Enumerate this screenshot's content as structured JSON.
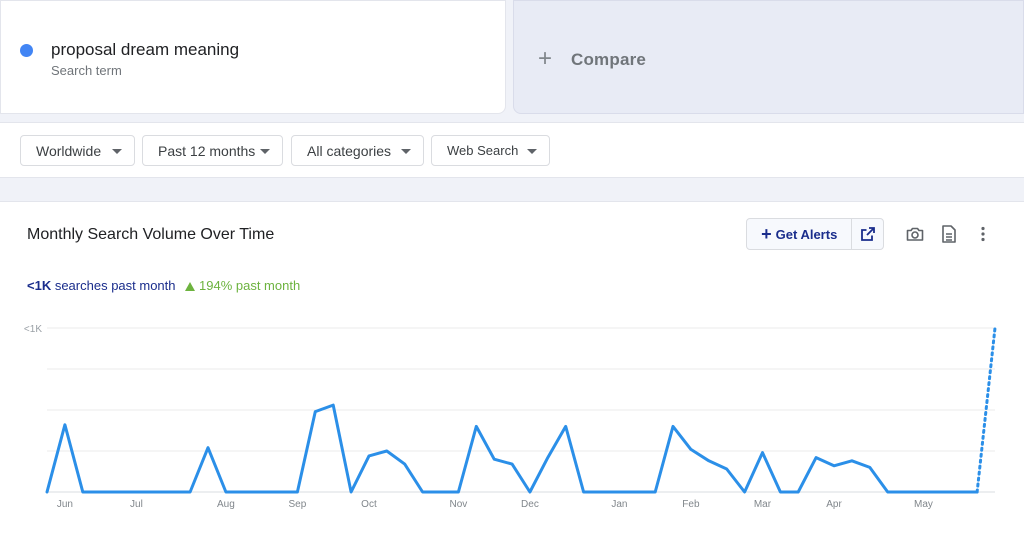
{
  "term": {
    "name": "proposal dream meaning",
    "type": "Search term",
    "color": "#4285f4"
  },
  "compare": {
    "plus": "+",
    "label": "Compare"
  },
  "filters": [
    {
      "label": "Worldwide"
    },
    {
      "label": "Past 12 months"
    },
    {
      "label": "All categories"
    },
    {
      "label": "Web Search"
    }
  ],
  "chart_card": {
    "title": "Monthly Search Volume Over Time",
    "alerts_label": "Get Alerts",
    "volume_value": "<1K",
    "volume_text": " searches past month",
    "change_text": "194% past month",
    "volume_color": "#1a2d8c",
    "change_color": "#6db33f"
  },
  "chart_data": {
    "type": "line",
    "y_tick_label": "<1K",
    "ylim": [
      0,
      100
    ],
    "grid": true,
    "month_labels": [
      "Jun",
      "Jul",
      "Aug",
      "Sep",
      "Oct",
      "Nov",
      "Dec",
      "Jan",
      "Feb",
      "Mar",
      "Apr",
      "May"
    ],
    "line_color": "#2b8fe8",
    "series": [
      {
        "values": [
          0,
          41,
          0,
          0,
          0,
          0,
          0,
          0,
          0,
          27,
          0,
          0,
          0,
          0,
          0,
          49,
          53,
          0,
          22,
          25,
          17,
          0,
          0,
          0,
          40,
          20,
          17,
          0,
          21,
          40,
          0,
          0,
          0,
          0,
          0,
          40,
          26,
          19,
          14,
          0,
          24,
          0,
          0,
          21,
          16,
          19,
          15,
          0,
          0,
          0,
          0,
          0,
          0
        ],
        "projected_last": 100
      }
    ]
  }
}
